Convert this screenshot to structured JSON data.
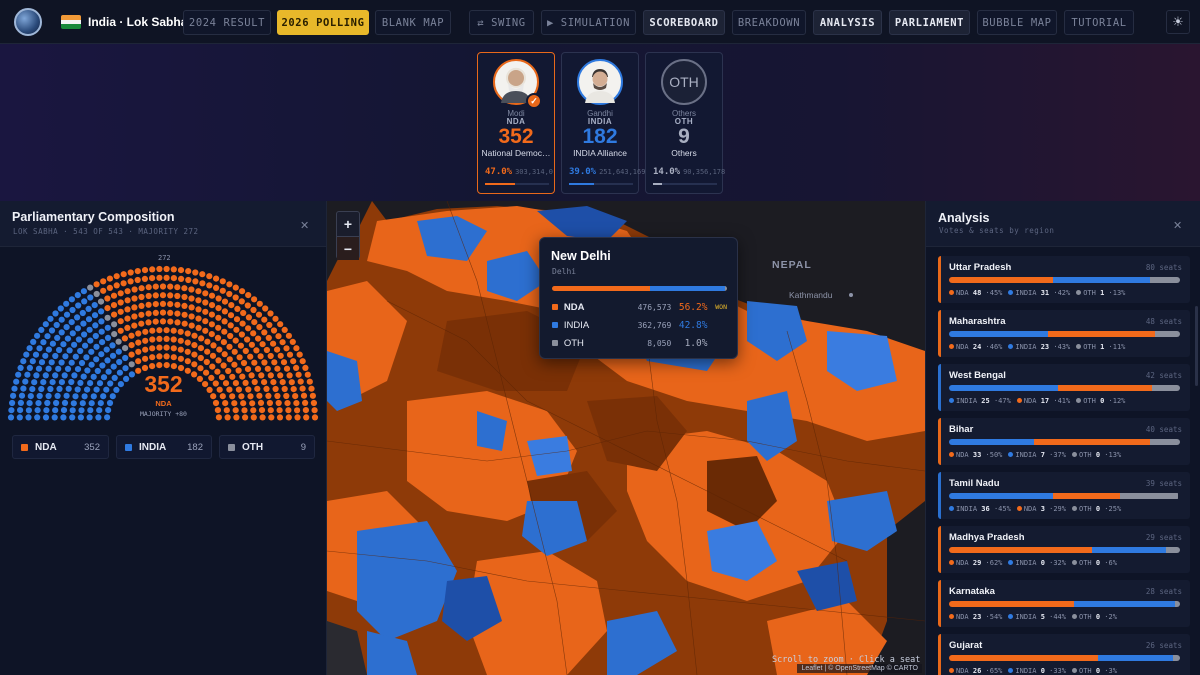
{
  "header": {
    "country": "India · Lok Sabha",
    "nav": [
      "2024 RESULT",
      "2026 POLLING",
      "BLANK MAP",
      "⇄ SWING",
      "▶ SIMULATION",
      "SCOREBOARD",
      "BREAKDOWN",
      "ANALYSIS",
      "PARLIAMENT",
      "BUBBLE MAP",
      "TUTORIAL"
    ],
    "active": "2026 POLLING"
  },
  "scoreboard": [
    {
      "leader": "Modi",
      "party": "NDA",
      "seats": "352",
      "name": "National Democ…",
      "pct": "47.0%",
      "votes": "303,314,0",
      "color": "#f26a1b",
      "winner": true
    },
    {
      "leader": "Gandhi",
      "party": "INDIA",
      "seats": "182",
      "name": "INDIA Alliance",
      "pct": "39.0%",
      "votes": "251,643,169",
      "color": "#2f7ae0",
      "winner": false
    },
    {
      "leader": "Others",
      "party": "OTH",
      "seats": "9",
      "name": "Others",
      "pct": "14.0%",
      "votes": "90,356,178",
      "color": "#8a8f9c",
      "winner": false,
      "badge": "OTH"
    }
  ],
  "parliament": {
    "title": "Parliamentary Composition",
    "subtitle": "LOK SABHA · 543 OF 543 · MAJORITY 272",
    "majority_mark": "272",
    "center_seats": "352",
    "center_party": "NDA",
    "center_note": "MAJORITY +80",
    "legend": [
      {
        "name": "NDA",
        "count": "352",
        "color": "#f26a1b"
      },
      {
        "name": "INDIA",
        "count": "182",
        "color": "#2f7ae0"
      },
      {
        "name": "OTH",
        "count": "9",
        "color": "#8a8f9c"
      }
    ]
  },
  "map": {
    "zoom_in": "+",
    "zoom_out": "−",
    "country_label": "NEPAL",
    "city_label": "Kathmandu",
    "hint": "Scroll to zoom · Click a seat",
    "attribution": "Leaflet | © OpenStreetMap © CARTO",
    "tooltip": {
      "title": "New Delhi",
      "subtitle": "Delhi",
      "won_label": "WON",
      "rows": [
        {
          "party": "NDA",
          "votes": "476,573",
          "pct": "56.2%",
          "color": "#f26a1b",
          "won": true
        },
        {
          "party": "INDIA",
          "votes": "362,769",
          "pct": "42.8%",
          "color": "#2f7ae0",
          "won": false
        },
        {
          "party": "OTH",
          "votes": "8,050",
          "pct": "1.0%",
          "color": "#8a8f9c",
          "won": false
        }
      ]
    }
  },
  "analysis": {
    "title": "Analysis",
    "subtitle": "Votes & seats by region",
    "regions": [
      {
        "name": "Uttar Pradesh",
        "seats": "80 seats",
        "lead": "nda",
        "bar": [
          0.45,
          0.42,
          0.13
        ],
        "order": [
          "nda",
          "india",
          "oth"
        ],
        "legend": [
          [
            "NDA",
            "48",
            "45%"
          ],
          [
            "INDIA",
            "31",
            "42%"
          ],
          [
            "OTH",
            "1",
            "13%"
          ]
        ]
      },
      {
        "name": "Maharashtra",
        "seats": "48 seats",
        "lead": "nda",
        "bar": [
          0.46,
          0.43,
          0.11
        ],
        "order": [
          "india",
          "nda",
          "oth"
        ],
        "legend": [
          [
            "NDA",
            "24",
            "46%"
          ],
          [
            "INDIA",
            "23",
            "43%"
          ],
          [
            "OTH",
            "1",
            "11%"
          ]
        ]
      },
      {
        "name": "West Bengal",
        "seats": "42 seats",
        "lead": "india",
        "bar": [
          0.41,
          0.47,
          0.12
        ],
        "order": [
          "india",
          "nda",
          "oth"
        ],
        "legend": [
          [
            "INDIA",
            "25",
            "47%"
          ],
          [
            "NDA",
            "17",
            "41%"
          ],
          [
            "OTH",
            "0",
            "12%"
          ]
        ]
      },
      {
        "name": "Bihar",
        "seats": "40 seats",
        "lead": "nda",
        "bar": [
          0.5,
          0.37,
          0.13
        ],
        "order": [
          "india",
          "nda",
          "oth"
        ],
        "legend": [
          [
            "NDA",
            "33",
            "50%"
          ],
          [
            "INDIA",
            "7",
            "37%"
          ],
          [
            "OTH",
            "0",
            "13%"
          ]
        ]
      },
      {
        "name": "Tamil Nadu",
        "seats": "39 seats",
        "lead": "india",
        "bar": [
          0.29,
          0.45,
          0.25
        ],
        "order": [
          "india",
          "nda",
          "oth"
        ],
        "legend": [
          [
            "INDIA",
            "36",
            "45%"
          ],
          [
            "NDA",
            "3",
            "29%"
          ],
          [
            "OTH",
            "0",
            "25%"
          ]
        ]
      },
      {
        "name": "Madhya Pradesh",
        "seats": "29 seats",
        "lead": "nda",
        "bar": [
          0.62,
          0.32,
          0.06
        ],
        "order": [
          "nda",
          "india",
          "oth"
        ],
        "legend": [
          [
            "NDA",
            "29",
            "62%"
          ],
          [
            "INDIA",
            "0",
            "32%"
          ],
          [
            "OTH",
            "0",
            "6%"
          ]
        ]
      },
      {
        "name": "Karnataka",
        "seats": "28 seats",
        "lead": "nda",
        "bar": [
          0.54,
          0.44,
          0.02
        ],
        "order": [
          "nda",
          "india",
          "oth"
        ],
        "legend": [
          [
            "NDA",
            "23",
            "54%"
          ],
          [
            "INDIA",
            "5",
            "44%"
          ],
          [
            "OTH",
            "0",
            "2%"
          ]
        ]
      },
      {
        "name": "Gujarat",
        "seats": "26 seats",
        "lead": "nda",
        "bar": [
          0.65,
          0.33,
          0.03
        ],
        "order": [
          "nda",
          "india",
          "oth"
        ],
        "legend": [
          [
            "NDA",
            "26",
            "65%"
          ],
          [
            "INDIA",
            "0",
            "33%"
          ],
          [
            "OTH",
            "0",
            "3%"
          ]
        ]
      }
    ]
  },
  "colors": {
    "nda": "#f26a1b",
    "india": "#2f7ae0",
    "oth": "#8a8f9c",
    "accent": "#e8b82a"
  }
}
